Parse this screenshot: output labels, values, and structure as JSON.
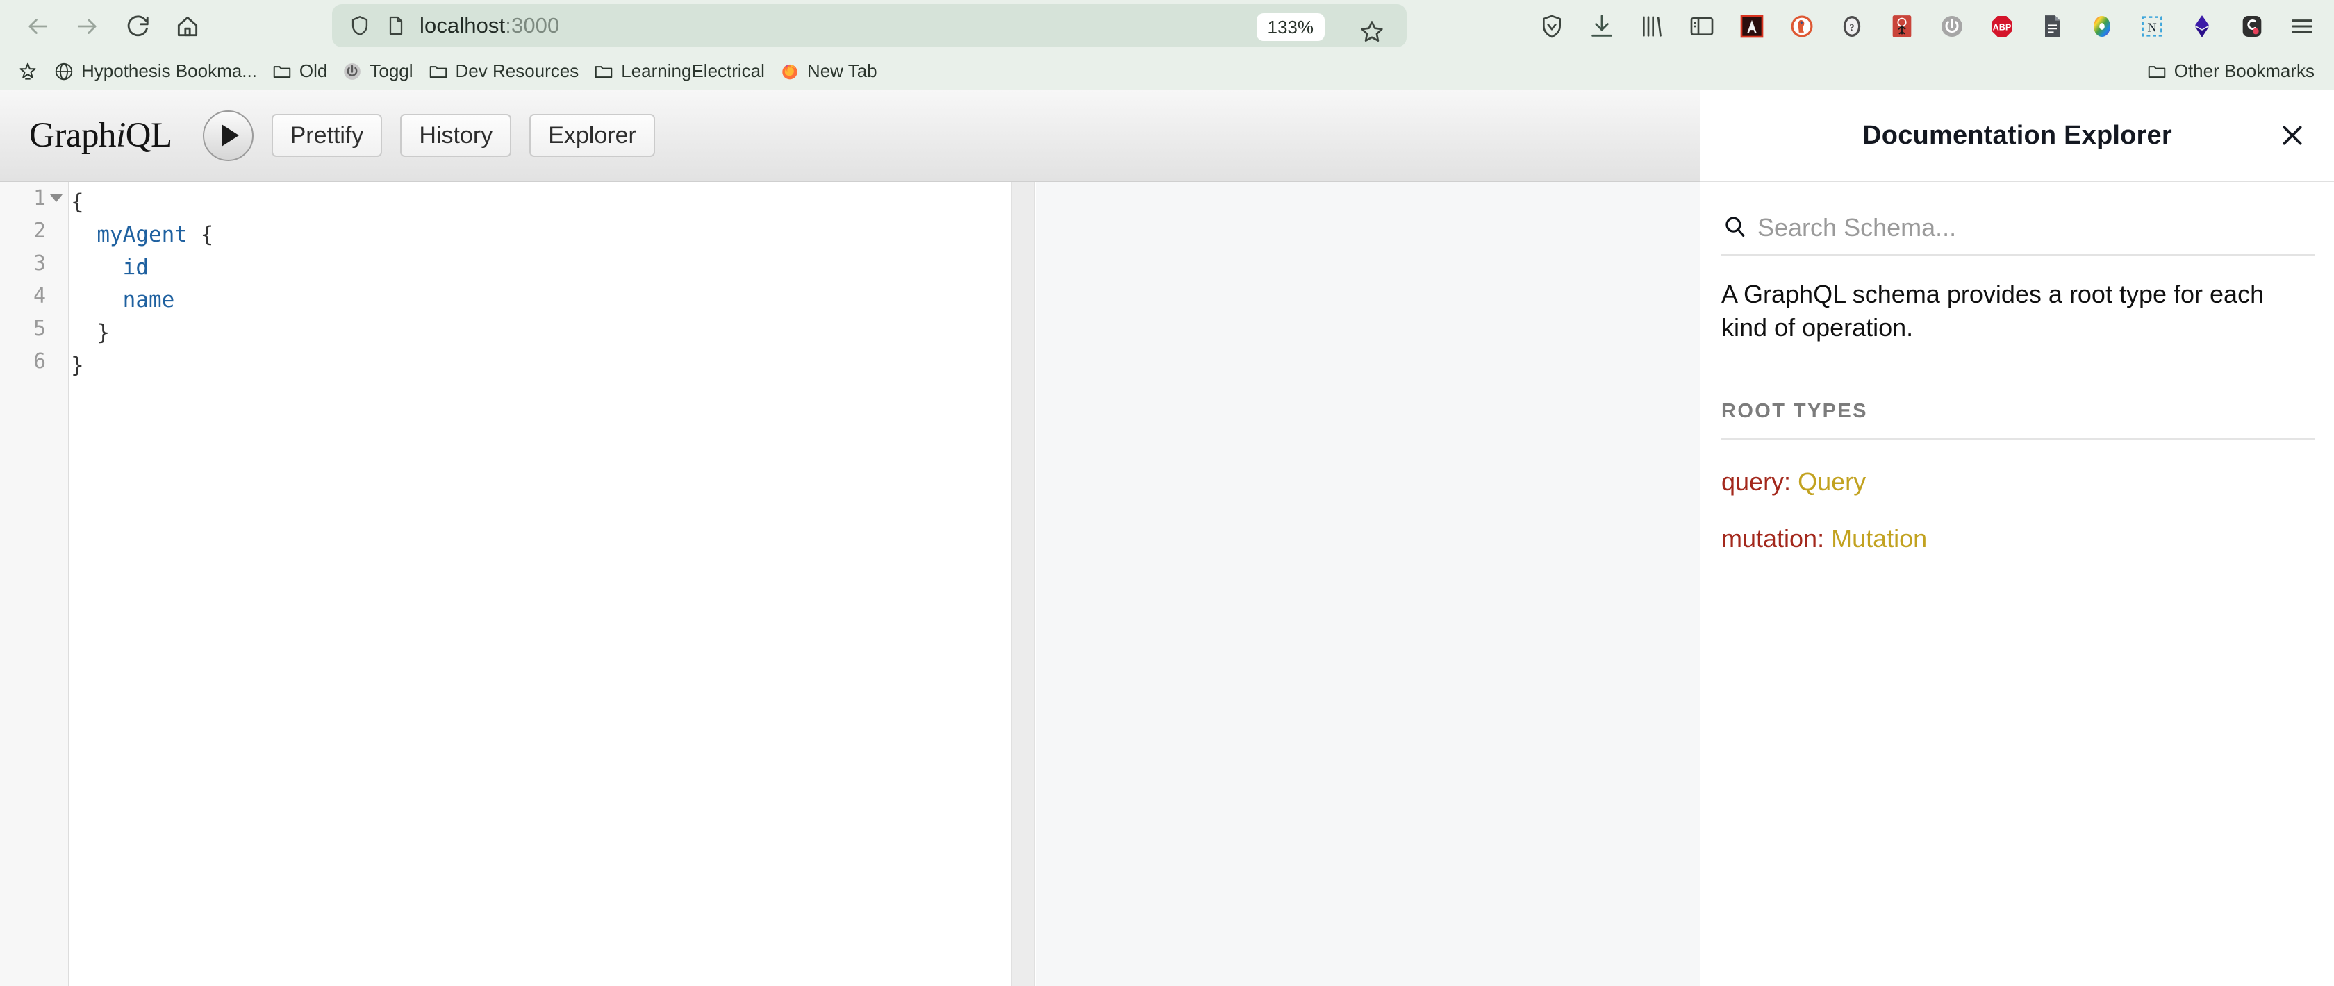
{
  "browser": {
    "nav": [
      {
        "name": "back-button",
        "icon": "arrow-left-icon"
      },
      {
        "name": "forward-button",
        "icon": "arrow-right-icon"
      },
      {
        "name": "reload-button",
        "icon": "reload-icon"
      },
      {
        "name": "home-button",
        "icon": "home-icon"
      }
    ],
    "urlbar": {
      "shield_icon": "shield-icon",
      "page_icon": "page-icon",
      "url_host": "localhost",
      "url_port": ":3000",
      "zoom_level": "133%",
      "bookmark_icon": "star-icon"
    },
    "extensions": [
      {
        "name": "bitwarden-icon",
        "label": "Bitwarden"
      },
      {
        "name": "downloads-icon",
        "label": "Downloads"
      },
      {
        "name": "library-icon",
        "label": "Library"
      },
      {
        "name": "sidebar-icon",
        "label": "Sidebars"
      },
      {
        "name": "adobe-acrobat-icon",
        "label": "Adobe Acrobat"
      },
      {
        "name": "duckduckgo-icon",
        "label": "DuckDuckGo Privacy Essentials"
      },
      {
        "name": "privacy-badger-icon",
        "label": "Privacy Badger"
      },
      {
        "name": "ublock-origin-icon",
        "label": "uBlock Origin"
      },
      {
        "name": "power-icon",
        "label": "Toggl Power"
      },
      {
        "name": "adblock-plus-icon",
        "label": "ABP"
      },
      {
        "name": "document-icon",
        "label": "Notes"
      },
      {
        "name": "colorpicker-icon",
        "label": "Color Picker"
      },
      {
        "name": "notion-clipper-icon",
        "label": "Notion Web Clipper"
      },
      {
        "name": "metamask-icon",
        "label": "MetaMask"
      },
      {
        "name": "pocket-icon",
        "label": "Pocket"
      },
      {
        "name": "app-menu-icon",
        "label": "Open application menu"
      }
    ],
    "bookmarks": {
      "items": [
        {
          "name": "bookmark-manage",
          "icon": "star-outline-icon",
          "label": ""
        },
        {
          "name": "bookmark-hypothesis",
          "icon": "globe-icon",
          "label": "Hypothesis Bookma..."
        },
        {
          "name": "bookmark-old",
          "icon": "folder-icon",
          "label": "Old"
        },
        {
          "name": "bookmark-toggl",
          "icon": "toggl-icon",
          "label": "Toggl"
        },
        {
          "name": "bookmark-dev-resources",
          "icon": "folder-icon",
          "label": "Dev Resources"
        },
        {
          "name": "bookmark-learningelectrical",
          "icon": "folder-icon",
          "label": "LearningElectrical"
        },
        {
          "name": "bookmark-new-tab",
          "icon": "firefox-icon",
          "label": "New Tab"
        }
      ],
      "other_label": "Other Bookmarks",
      "other_icon": "folder-icon"
    }
  },
  "graphiql": {
    "logo_prefix": "Graph",
    "logo_italic": "i",
    "logo_suffix": "QL",
    "execute_label": "Execute Query",
    "toolbar_buttons": [
      {
        "name": "prettify-button",
        "label": "Prettify"
      },
      {
        "name": "history-button",
        "label": "History"
      },
      {
        "name": "explorer-button",
        "label": "Explorer"
      }
    ],
    "editor": {
      "line_numbers": [
        "1",
        "2",
        "3",
        "4",
        "5",
        "6"
      ],
      "lines": [
        [
          {
            "t": "{",
            "c": "punct"
          }
        ],
        [
          {
            "t": "  ",
            "c": "punct"
          },
          {
            "t": "myAgent",
            "c": "field"
          },
          {
            "t": " {",
            "c": "punct"
          }
        ],
        [
          {
            "t": "    ",
            "c": "punct"
          },
          {
            "t": "id",
            "c": "field"
          }
        ],
        [
          {
            "t": "    ",
            "c": "punct"
          },
          {
            "t": "name",
            "c": "field"
          }
        ],
        [
          {
            "t": "  }",
            "c": "punct"
          }
        ],
        [
          {
            "t": "}",
            "c": "punct"
          }
        ]
      ]
    },
    "result": {
      "content": ""
    }
  },
  "docs": {
    "title": "Documentation Explorer",
    "close_icon": "close-icon",
    "search_icon": "search-icon",
    "search_placeholder": "Search Schema...",
    "search_value": "",
    "description": "A GraphQL schema provides a root type for each kind of operation.",
    "section_label": "ROOT TYPES",
    "root_types": [
      {
        "key": "query:",
        "value": "Query"
      },
      {
        "key": "mutation:",
        "value": "Mutation"
      }
    ]
  },
  "colors": {
    "chrome_bg": "#e9f0ea",
    "urlbar_bg": "#d6e3d9",
    "field_token": "#1f61a0",
    "docs_key": "#a3281c",
    "docs_type": "#c2a220"
  }
}
